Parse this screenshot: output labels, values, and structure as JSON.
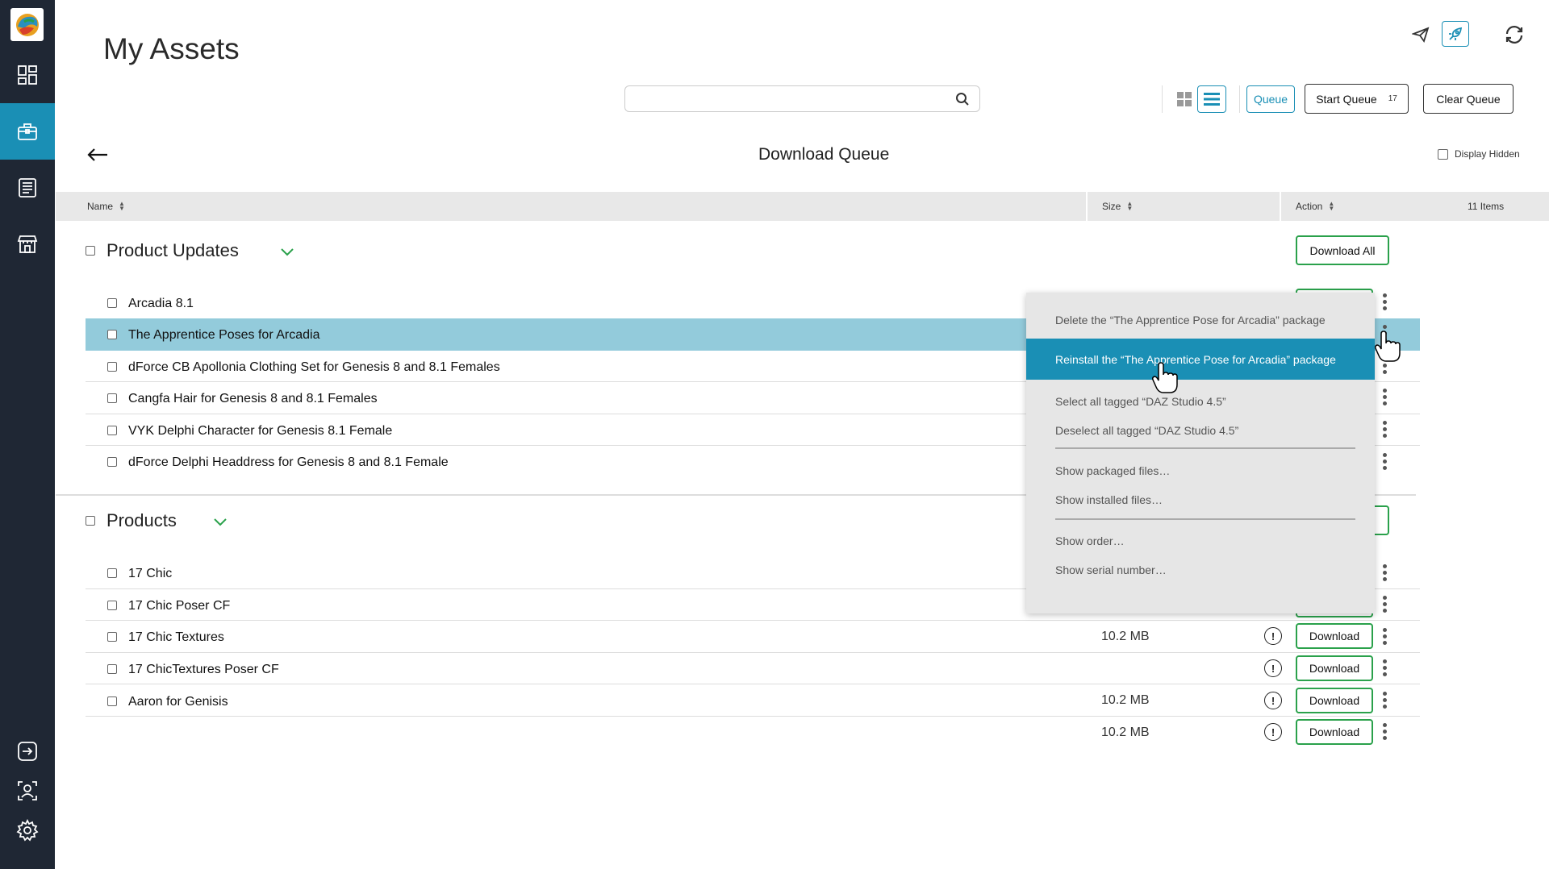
{
  "app": {
    "title": "My Assets"
  },
  "sidebar": {
    "items": [
      {
        "name": "dashboard",
        "icon": "dashboard-icon"
      },
      {
        "name": "my-assets",
        "icon": "briefcase-icon",
        "active": true
      },
      {
        "name": "catalog",
        "icon": "document-list-icon"
      },
      {
        "name": "store",
        "icon": "store-icon"
      }
    ],
    "bottom": [
      {
        "name": "logout",
        "icon": "logout-icon"
      },
      {
        "name": "account",
        "icon": "user-icon"
      },
      {
        "name": "settings",
        "icon": "gear-icon"
      }
    ],
    "colors": {
      "background": "#1f2734",
      "active": "#1a8fb5"
    }
  },
  "toolbar": {
    "search_placeholder": "",
    "search_value": "",
    "queue_label": "Queue",
    "start_queue_label": "Start Queue",
    "start_queue_count": "17",
    "clear_queue_label": "Clear Queue"
  },
  "queue": {
    "title": "Download Queue",
    "display_hidden_label": "Display Hidden",
    "items_count": "11 Items"
  },
  "table": {
    "columns": {
      "name": "Name",
      "size": "Size",
      "action": "Action"
    }
  },
  "groups": [
    {
      "name": "Product Updates",
      "action_label": "Download All",
      "rows": [
        {
          "name": "Arcadia 8.1"
        },
        {
          "name": "The Apprentice Poses for Arcadia",
          "selected": true
        },
        {
          "name": "dForce CB Apollonia Clothing Set for Genesis 8 and 8.1 Females"
        },
        {
          "name": "Cangfa Hair for Genesis 8 and 8.1 Females"
        },
        {
          "name": "VYK Delphi Character for Genesis 8.1 Female"
        },
        {
          "name": "dForce Delphi Headdress for Genesis 8 and 8.1 Female"
        }
      ]
    },
    {
      "name": "Products",
      "rows": [
        {
          "name": "17 Chic"
        },
        {
          "name": "17 Chic Poser CF"
        },
        {
          "name": "17 Chic Textures",
          "size": "10.2 MB",
          "action": "Download"
        },
        {
          "name": "17 ChicTextures Poser CF",
          "size": "",
          "action": "Download"
        },
        {
          "name": "Aaron for Genisis",
          "size": "10.2 MB",
          "action": "Download"
        },
        {
          "name": "",
          "size": "10.2 MB",
          "action": "Download"
        }
      ]
    }
  ],
  "context_menu": {
    "items": [
      "Delete the “The Apprentice Pose for Arcadia” package",
      "Reinstall the “The Apprentice Pose for Arcadia” package",
      "Select all tagged “DAZ Studio 4.5”",
      "Deselect all tagged “DAZ Studio 4.5”",
      "Show packaged files…",
      "Show installed files…",
      "Show order…",
      "Show serial number…"
    ],
    "highlighted_index": 1
  }
}
